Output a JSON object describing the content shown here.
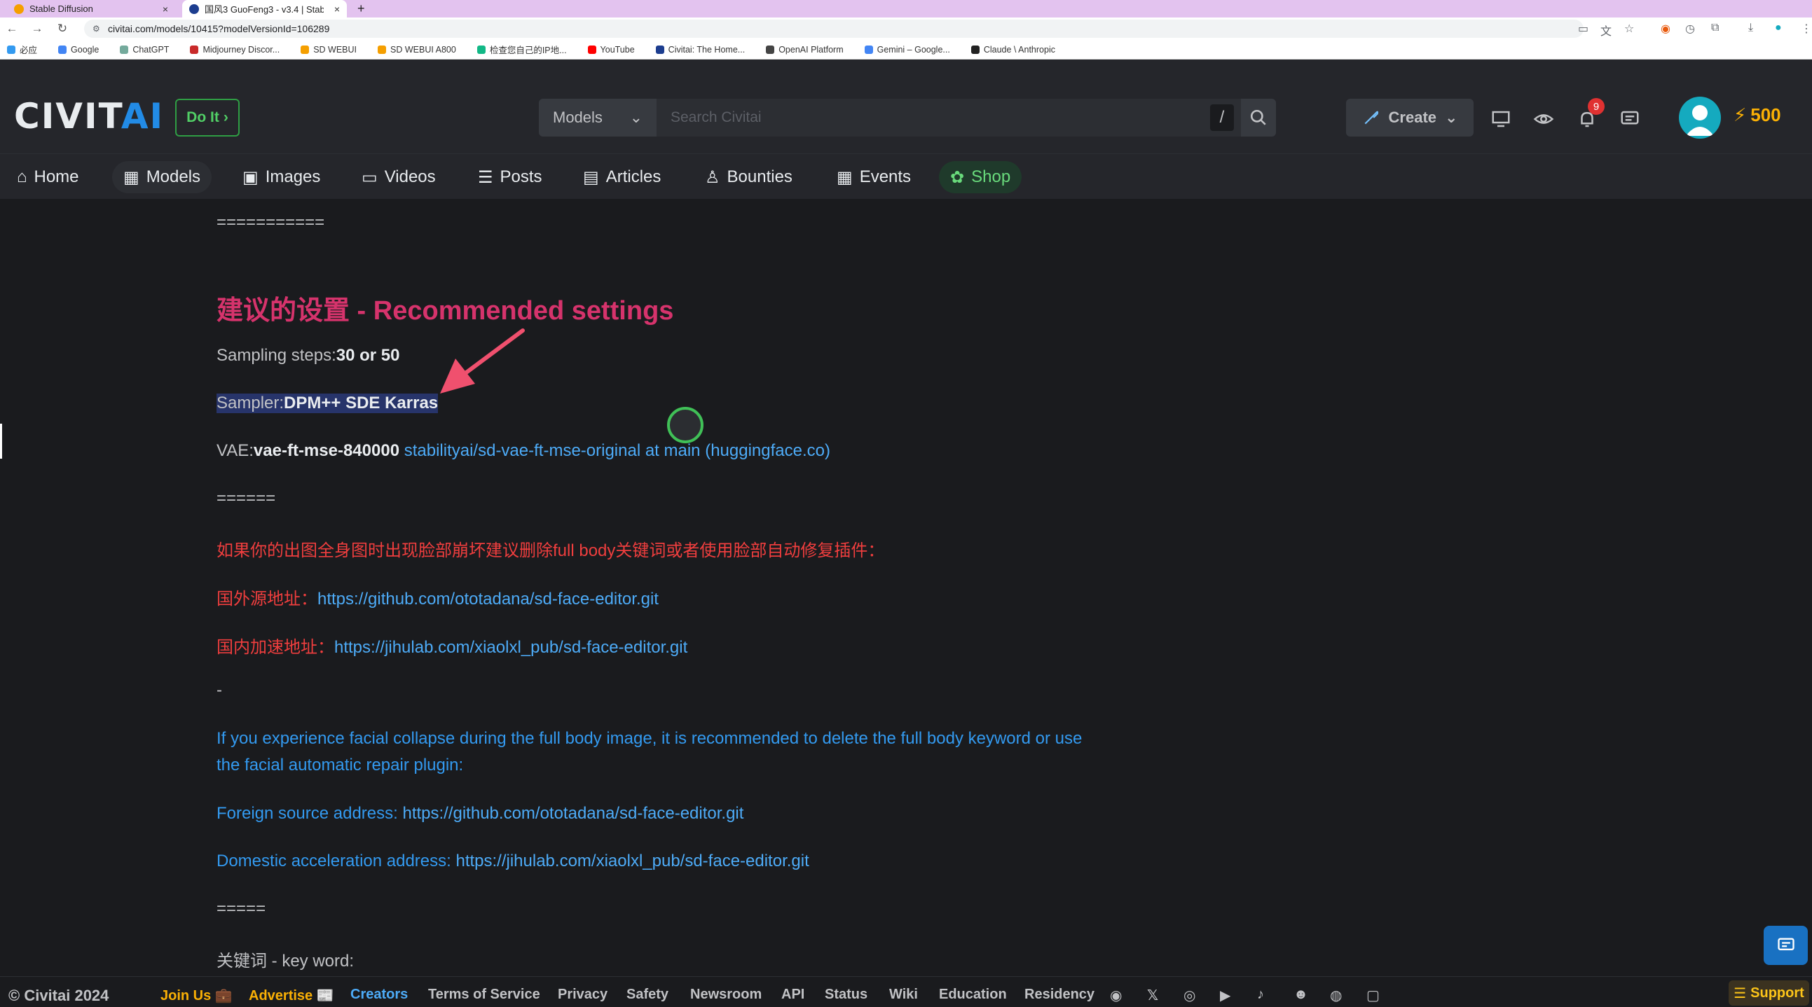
{
  "browser": {
    "tabs": [
      {
        "title": "Stable Diffusion",
        "active": false
      },
      {
        "title": "国风3 GuoFeng3 - v3.4 | Stab",
        "active": true
      }
    ],
    "new_tab": "+",
    "url": "civitai.com/models/10415?modelVersionId=106289",
    "bookmarks": [
      "必应",
      "Google",
      "ChatGPT",
      "Midjourney Discor...",
      "SD WEBUI",
      "SD WEBUI A800",
      "检查您自己的IP地...",
      "YouTube",
      "Civitai: The Home...",
      "OpenAI Platform",
      "Gemini – Google...",
      "Claude \\ Anthropic"
    ]
  },
  "header": {
    "logo_main": "CIVIT",
    "logo_ai": "AI",
    "doit_label": "Do It",
    "search_scope": "Models",
    "search_placeholder": "Search Civitai",
    "search_shortcut": "/",
    "create_label": "Create",
    "notification_count": "9",
    "buzz_amount": "500"
  },
  "nav": {
    "items": [
      "Home",
      "Models",
      "Images",
      "Videos",
      "Posts",
      "Articles",
      "Bounties",
      "Events",
      "Shop"
    ],
    "active": "Models"
  },
  "content": {
    "sep1": "===========",
    "heading": "建议的设置 - Recommended settings",
    "steps_label": "Sampling steps:",
    "steps_value": "30 or 50",
    "sampler_label": "Sampler:",
    "sampler_value": "DPM++ SDE Karras",
    "vae_label": "VAE:",
    "vae_value": "vae-ft-mse-840000",
    "vae_link": "stabilityai/sd-vae-ft-mse-original at main (huggingface.co)",
    "sep2": "======",
    "cn_warning": "如果你的出图全身图时出现脸部崩坏建议删除full body关键词或者使用脸部自动修复插件：",
    "cn_foreign_label": "国外源地址：",
    "cn_foreign_link": "https://github.com/ototadana/sd-face-editor.git",
    "cn_domestic_label": "国内加速地址：",
    "cn_domestic_link": "https://jihulab.com/xiaolxl_pub/sd-face-editor.git",
    "dash": "-",
    "en_warning_1": "If you experience facial collapse during the full body image, it is recommended to delete the full body keyword or use",
    "en_warning_2": "the facial automatic repair plugin:",
    "en_foreign_label": "Foreign source address: ",
    "en_foreign_link": "https://github.com/ototadana/sd-face-editor.git",
    "en_domestic_label": "Domestic acceleration address: ",
    "en_domestic_link": "https://jihulab.com/xiaolxl_pub/sd-face-editor.git",
    "sep3": "=====",
    "keyword_label": "关键词 - key word:"
  },
  "footer": {
    "copyright": "© Civitai 2024",
    "links": [
      "Join Us 💼",
      "Advertise 📰",
      "Creators",
      "Terms of Service",
      "Privacy",
      "Safety",
      "Newsroom",
      "API",
      "Status",
      "Wiki",
      "Education",
      "Residency"
    ],
    "support_label": "Support"
  },
  "colors": {
    "accent_blue": "#228be6",
    "heading_pink": "#d6336c",
    "warning_red": "#f03e3e",
    "link_blue": "#4dabf7",
    "shop_green": "#69db7c"
  }
}
